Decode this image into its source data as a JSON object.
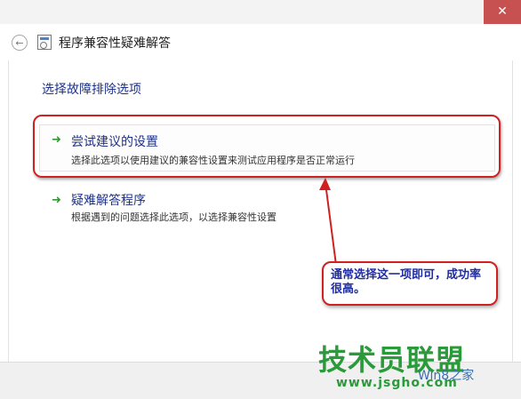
{
  "window": {
    "title": "程序兼容性疑难解答",
    "close_glyph": "✕",
    "back_glyph": "←",
    "back_icon": "back-arrow-icon",
    "app_icon": "troubleshooter-icon"
  },
  "main": {
    "heading": "选择故障排除选项",
    "options": [
      {
        "title": "尝试建议的设置",
        "description": "选择此选项以使用建议的兼容性设置来测试应用程序是否正常运行",
        "icon": "green-arrow-icon",
        "glyph": "➜"
      },
      {
        "title": "疑难解答程序",
        "description": "根据遇到的问题选择此选项，以选择兼容性设置",
        "icon": "green-arrow-icon",
        "glyph": "➜"
      }
    ]
  },
  "annotation": {
    "text": "通常选择这一项即可，成功率很高。",
    "color": "#d02020"
  },
  "watermark": {
    "main": "技术员联盟",
    "site": "www.jsgho.com",
    "sub": "Win8之家"
  }
}
